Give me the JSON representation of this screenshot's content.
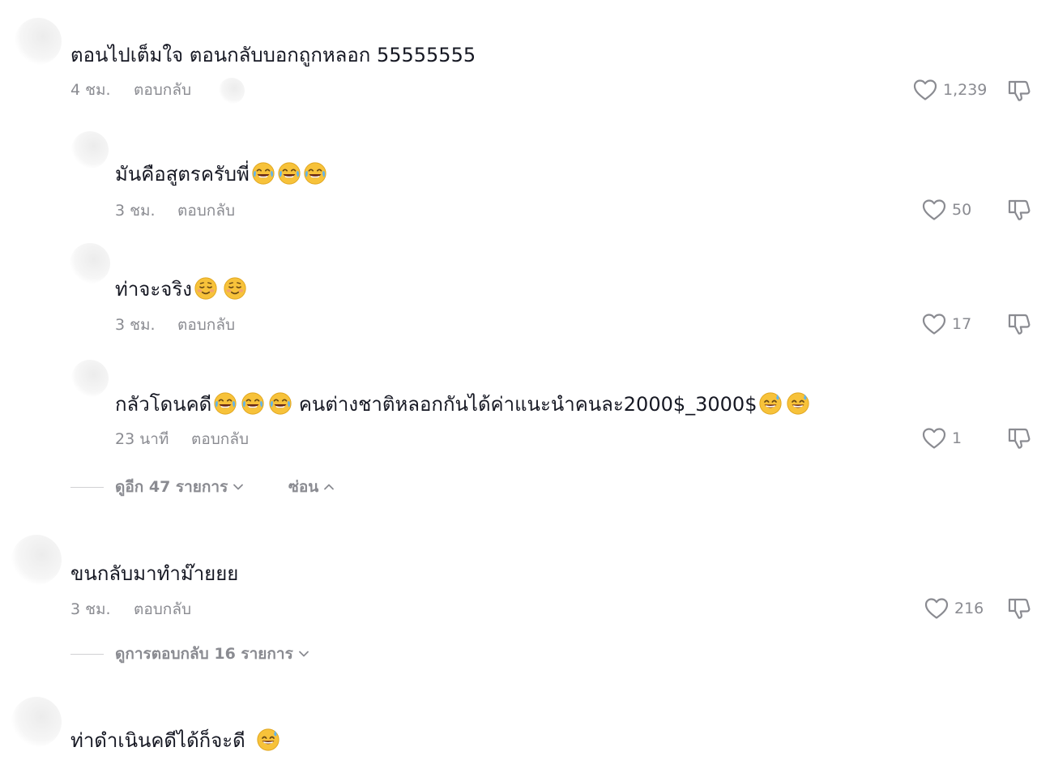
{
  "comments": [
    {
      "text": "ตอนไปเต็มใจ ตอนกลับบอกถูกหลอก 55555555",
      "time": "4 ชม.",
      "reply": "ตอบกลับ",
      "likes": "1,239"
    },
    {
      "text": "มันคือสูตรครับพี่",
      "emoji": [
        "joy",
        "joy",
        "joy"
      ],
      "time": "3 ชม.",
      "reply": "ตอบกลับ",
      "likes": "50"
    },
    {
      "text": "ท่าจะจริง",
      "emoji": [
        "blush",
        "blush"
      ],
      "time": "3 ชม.",
      "reply": "ตอบกลับ",
      "likes": "17"
    },
    {
      "text_a": "กลัวโดนคดี",
      "text_b": " คนต่างชาติหลอกกันได้ค่าแนะนำคนละ2000$_3000$",
      "emoji_a": [
        "joy",
        "joy",
        "joy"
      ],
      "emoji_b": [
        "sweat-smile",
        "sweat-smile"
      ],
      "time": "23 นาที",
      "reply": "ตอบกลับ",
      "likes": "1"
    },
    {
      "text": "ขนกลับมาทำม๊ายยย",
      "time": "3 ชม.",
      "reply": "ตอบกลับ",
      "likes": "216"
    },
    {
      "text": "ท่าดำเนินคดีได้ก็จะดี",
      "emoji": [
        "sweat-smile"
      ]
    }
  ],
  "thread1": {
    "view_more": "ดูอีก 47 รายการ",
    "hide": "ซ่อน"
  },
  "thread2": {
    "view_replies": "ดูการตอบกลับ 16 รายการ"
  },
  "colors": {
    "text": "#161823",
    "muted": "#8a8b91"
  }
}
